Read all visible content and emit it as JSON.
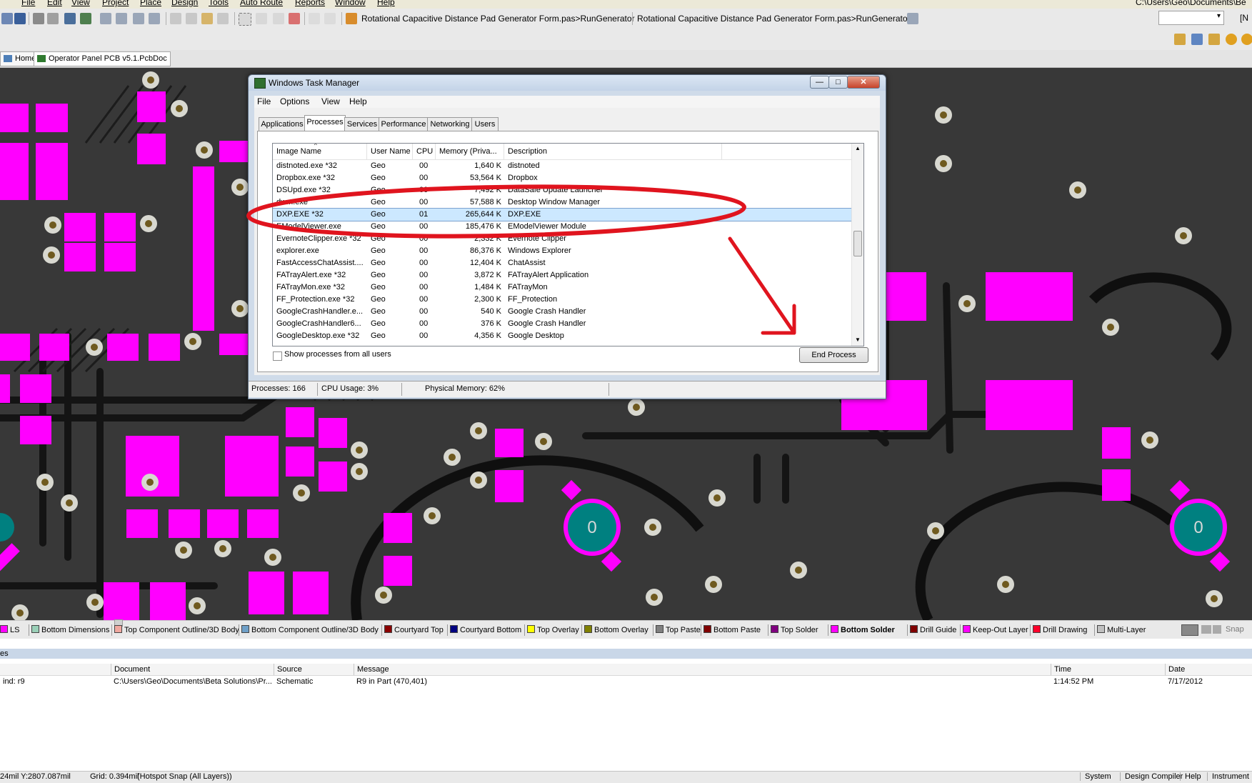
{
  "app": {
    "menu": [
      "File",
      "Edit",
      "View",
      "Project",
      "Place",
      "Design",
      "Tools",
      "Auto Route",
      "Reports",
      "Window",
      "Help"
    ],
    "toolbar_script_1": "Rotational Capacitive Distance Pad Generator Form.pas>RunGenerator",
    "toolbar_script_2": "Rotational Capacitive Distance Pad Generator Form.pas>RunGenerator",
    "path_text": "C:\\Users\\Geo\\Documents\\Be",
    "right_combo_value": "",
    "right_partial_text": "[N"
  },
  "doc_tabs": [
    {
      "label": "Home"
    },
    {
      "label": "Operator Panel PCB v5.1.PcbDoc"
    }
  ],
  "pcb": {
    "pad_label_1": "0",
    "pad_label_2": "0"
  },
  "task_manager": {
    "title": "Windows Task Manager",
    "window_buttons": {
      "minimize": "—",
      "maximize": "□",
      "close": "✕"
    },
    "menu": [
      "File",
      "Options",
      "View",
      "Help"
    ],
    "tabs": [
      "Applications",
      "Processes",
      "Services",
      "Performance",
      "Networking",
      "Users"
    ],
    "active_tab": "Processes",
    "columns": [
      "Image Name",
      "User Name",
      "CPU",
      "Memory (Priva...",
      "Description"
    ],
    "rows": [
      {
        "name": "distnoted.exe *32",
        "user": "Geo",
        "cpu": "00",
        "mem": "1,640 K",
        "desc": "distnoted"
      },
      {
        "name": "Dropbox.exe *32",
        "user": "Geo",
        "cpu": "00",
        "mem": "53,564 K",
        "desc": "Dropbox"
      },
      {
        "name": "DSUpd.exe *32",
        "user": "Geo",
        "cpu": "00",
        "mem": "7,492 K",
        "desc": "DataSafe Update Launcher"
      },
      {
        "name": "dwm.exe",
        "user": "Geo",
        "cpu": "00",
        "mem": "57,588 K",
        "desc": "Desktop Window Manager"
      },
      {
        "name": "DXP.EXE *32",
        "user": "Geo",
        "cpu": "01",
        "mem": "265,644 K",
        "desc": "DXP.EXE",
        "selected": true
      },
      {
        "name": "EModelViewer.exe",
        "user": "Geo",
        "cpu": "00",
        "mem": "185,476 K",
        "desc": "EModelViewer Module"
      },
      {
        "name": "EvernoteClipper.exe *32",
        "user": "Geo",
        "cpu": "00",
        "mem": "2,332 K",
        "desc": "Evernote Clipper"
      },
      {
        "name": "explorer.exe",
        "user": "Geo",
        "cpu": "00",
        "mem": "86,376 K",
        "desc": "Windows Explorer"
      },
      {
        "name": "FastAccessChatAssist....",
        "user": "Geo",
        "cpu": "00",
        "mem": "12,404 K",
        "desc": "ChatAssist"
      },
      {
        "name": "FATrayAlert.exe *32",
        "user": "Geo",
        "cpu": "00",
        "mem": "3,872 K",
        "desc": "FATrayAlert Application"
      },
      {
        "name": "FATrayMon.exe *32",
        "user": "Geo",
        "cpu": "00",
        "mem": "1,484 K",
        "desc": "FATrayMon"
      },
      {
        "name": "FF_Protection.exe *32",
        "user": "Geo",
        "cpu": "00",
        "mem": "2,300 K",
        "desc": "FF_Protection"
      },
      {
        "name": "GoogleCrashHandler.e...",
        "user": "Geo",
        "cpu": "00",
        "mem": "540 K",
        "desc": "Google Crash Handler"
      },
      {
        "name": "GoogleCrashHandler6...",
        "user": "Geo",
        "cpu": "00",
        "mem": "376 K",
        "desc": "Google Crash Handler"
      },
      {
        "name": "GoogleDesktop.exe *32",
        "user": "Geo",
        "cpu": "00",
        "mem": "4,356 K",
        "desc": "Google Desktop"
      }
    ],
    "show_all_label": "Show processes from all users",
    "end_process_label": "End Process",
    "status": {
      "processes": "Processes: 166",
      "cpu": "CPU Usage: 3%",
      "memory": "Physical Memory: 62%"
    }
  },
  "annotation_colors": {
    "ellipse": "#e0141e",
    "arrow": "#e0141e"
  },
  "layer_tabs": [
    {
      "label": "LS",
      "color": "#ff00ff"
    },
    {
      "label": "Bottom Dimensions",
      "color": "#9ad0b8"
    },
    {
      "label": "Top Component Outline/3D Body",
      "color": "#f0a8a0"
    },
    {
      "label": "Bottom Component Outline/3D Body",
      "color": "#6fa0c8"
    },
    {
      "label": "Courtyard Top",
      "color": "#8b0000"
    },
    {
      "label": "Courtyard Bottom",
      "color": "#000080"
    },
    {
      "label": "Top Overlay",
      "color": "#ffff00"
    },
    {
      "label": "Bottom Overlay",
      "color": "#808000"
    },
    {
      "label": "Top Paste",
      "color": "#808080"
    },
    {
      "label": "Bottom Paste",
      "color": "#800000"
    },
    {
      "label": "Top Solder",
      "color": "#800080"
    },
    {
      "label": "Bottom Solder",
      "color": "#ff00ff",
      "active": true
    },
    {
      "label": "Drill Guide",
      "color": "#800000"
    },
    {
      "label": "Keep-Out Layer",
      "color": "#ff00ff"
    },
    {
      "label": "Drill Drawing",
      "color": "#ff002a"
    },
    {
      "label": "Multi-Layer",
      "color": "#c0c0c0"
    }
  ],
  "layer_right": {
    "snap": "Snap"
  },
  "messages": {
    "title": "es",
    "columns": [
      "Document",
      "Source",
      "Message",
      "Time",
      "Date"
    ],
    "row": {
      "class": "ind: r9",
      "document": "C:\\Users\\Geo\\Documents\\Beta Solutions\\Pr...",
      "source": "Schematic",
      "message": "R9 in Part (470,401)",
      "time": "1:14:52 PM",
      "date": "7/17/2012"
    }
  },
  "statusbar": {
    "coords": "24mil Y:2807.087mil",
    "grid": "Grid: 0.394mil",
    "snap": "(Hotspot Snap (All Layers))",
    "buttons": [
      "System",
      "Design Compiler",
      "Help",
      "Instrument"
    ]
  }
}
